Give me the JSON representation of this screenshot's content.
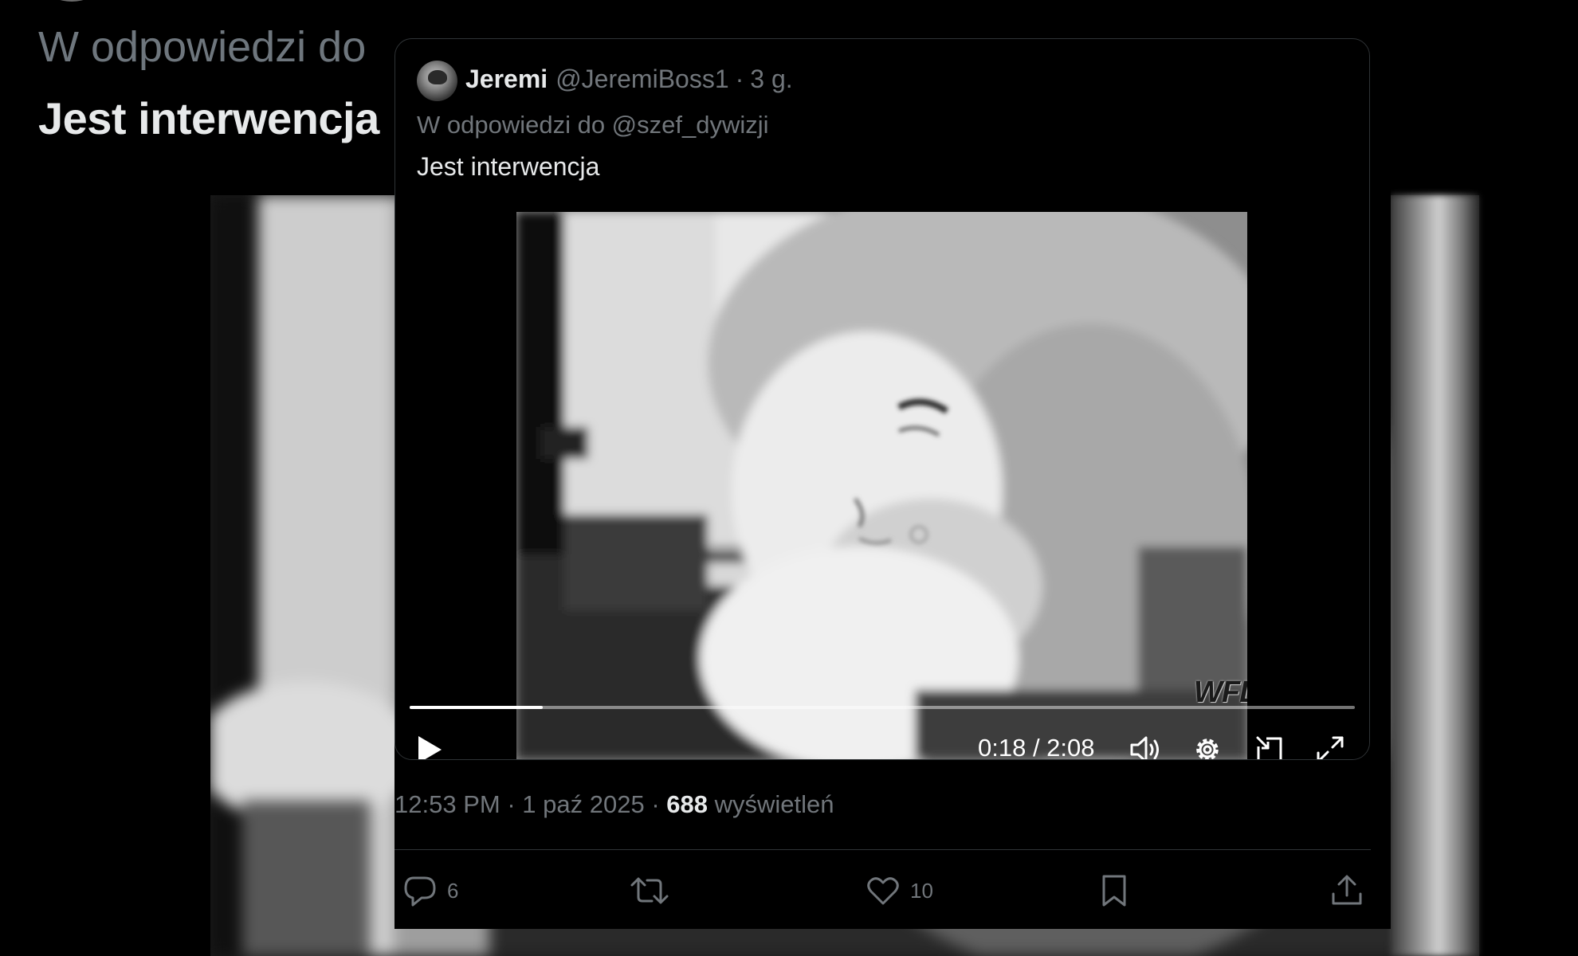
{
  "background": {
    "reply_label": "W odpowiedzi do",
    "tweet_text": "Jest interwencja"
  },
  "quote": {
    "author_name": "Jeremi",
    "author_handle": "@JeremiBoss1",
    "separator": "·",
    "relative_time": "3 g.",
    "reply_to": "W odpowiedzi do @szef_dywizji",
    "text": "Jest interwencja",
    "video": {
      "watermark": "WFDiF",
      "current_time": "0:18",
      "duration": "2:08",
      "time_display": "0:18 / 2:08",
      "progress": 0.141,
      "icons": [
        "play-icon",
        "volume-icon",
        "settings-gear-icon",
        "dock-icon",
        "fullscreen-icon"
      ]
    }
  },
  "meta": {
    "time": "12:53 PM",
    "dot": "·",
    "date": "1 paź 2025",
    "views_count": "688",
    "views_label": "wyświetleń"
  },
  "actions": {
    "replies": "6",
    "retweets": "",
    "likes": "10"
  },
  "colors": {
    "background": "#000000",
    "text_primary": "#e7e9ea",
    "text_secondary": "#71767b",
    "border": "#2f3336"
  }
}
